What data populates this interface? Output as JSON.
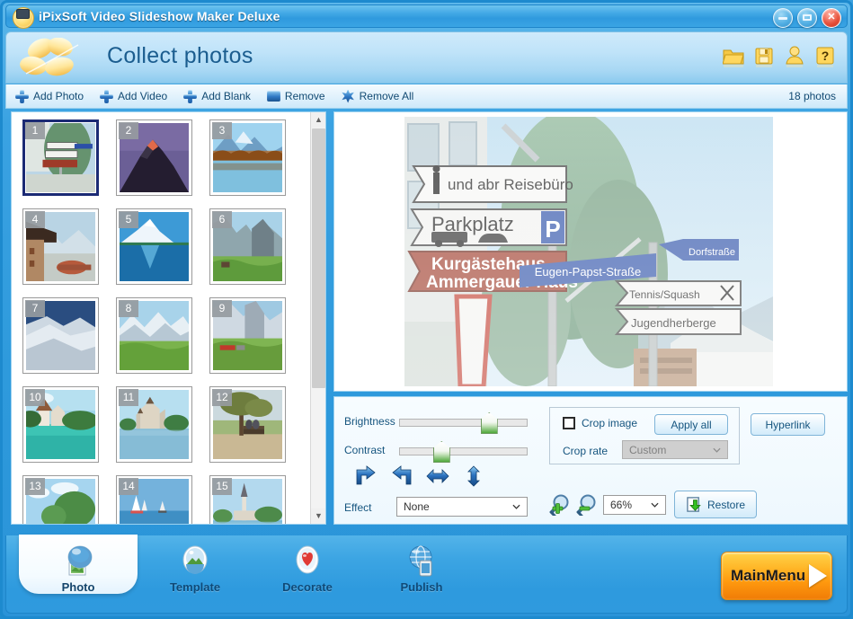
{
  "window": {
    "title": "iPixSoft Video Slideshow Maker Deluxe",
    "minimize_label": "Minimize",
    "maximize_label": "Maximize",
    "close_label": "Close"
  },
  "header": {
    "page_title": "Collect photos",
    "icons": [
      {
        "name": "open-project-icon",
        "label": "Open"
      },
      {
        "name": "save-project-icon",
        "label": "Save"
      },
      {
        "name": "user-account-icon",
        "label": "Account"
      },
      {
        "name": "help-icon",
        "label": "Help"
      }
    ]
  },
  "toolbar": {
    "items": [
      {
        "label": "Add Photo",
        "icon": "plus-icon"
      },
      {
        "label": "Add Video",
        "icon": "plus-icon"
      },
      {
        "label": "Add Blank",
        "icon": "plus-icon"
      },
      {
        "label": "Remove",
        "icon": "bar-icon"
      },
      {
        "label": "Remove All",
        "icon": "star-icon"
      }
    ],
    "photos_count": "18 photos"
  },
  "thumbnails": {
    "items": [
      {
        "num": "1",
        "selected": true
      },
      {
        "num": "2",
        "selected": false
      },
      {
        "num": "3",
        "selected": false
      },
      {
        "num": "4",
        "selected": false
      },
      {
        "num": "5",
        "selected": false
      },
      {
        "num": "6",
        "selected": false
      },
      {
        "num": "7",
        "selected": false
      },
      {
        "num": "8",
        "selected": false
      },
      {
        "num": "9",
        "selected": false
      },
      {
        "num": "10",
        "selected": false
      },
      {
        "num": "11",
        "selected": false
      },
      {
        "num": "12",
        "selected": false
      },
      {
        "num": "13",
        "selected": false
      },
      {
        "num": "14",
        "selected": false
      },
      {
        "num": "15",
        "selected": false
      }
    ],
    "scroll_up": "▲",
    "scroll_down": "▼"
  },
  "preview": {
    "signs": [
      "und abr Reisebüro",
      "Parkplatz",
      "Kurgästehaus",
      "Ammergauer Haus",
      "Eugen-Papst-Straße",
      "Dorfstraße",
      "Tennis/Squash",
      "Jugendherberge"
    ]
  },
  "controls": {
    "brightness_label": "Brightness",
    "brightness_value": 72,
    "contrast_label": "Contrast",
    "contrast_value": 30,
    "effect_label": "Effect",
    "effect_value": "None",
    "transform_buttons": [
      {
        "name": "rotate-right-icon",
        "label": "Rotate right"
      },
      {
        "name": "rotate-left-icon",
        "label": "Rotate left"
      },
      {
        "name": "flip-horizontal-icon",
        "label": "Flip horizontal"
      },
      {
        "name": "flip-vertical-icon",
        "label": "Flip vertical"
      }
    ],
    "crop_image_label": "Crop image",
    "crop_image_checked": false,
    "apply_all_label": "Apply all",
    "crop_rate_label": "Crop rate",
    "crop_rate_value": "Custom",
    "hyperlink_label": "Hyperlink",
    "zoom_in_label": "Zoom in",
    "zoom_out_label": "Zoom out",
    "zoom_value": "66%",
    "restore_label": "Restore"
  },
  "bottom_nav": {
    "tabs": [
      {
        "label": "Photo",
        "active": true,
        "icon": "photo-icon"
      },
      {
        "label": "Template",
        "active": false,
        "icon": "template-icon"
      },
      {
        "label": "Decorate",
        "active": false,
        "icon": "heart-icon"
      },
      {
        "label": "Publish",
        "active": false,
        "icon": "globe-icon"
      }
    ],
    "main_menu_label": "MainMenu"
  },
  "colors": {
    "accent_blue": "#2e9ade",
    "title_blue": "#1b5d8f",
    "orange": "#ff9a0f",
    "selection_navy": "#1b2a74"
  }
}
